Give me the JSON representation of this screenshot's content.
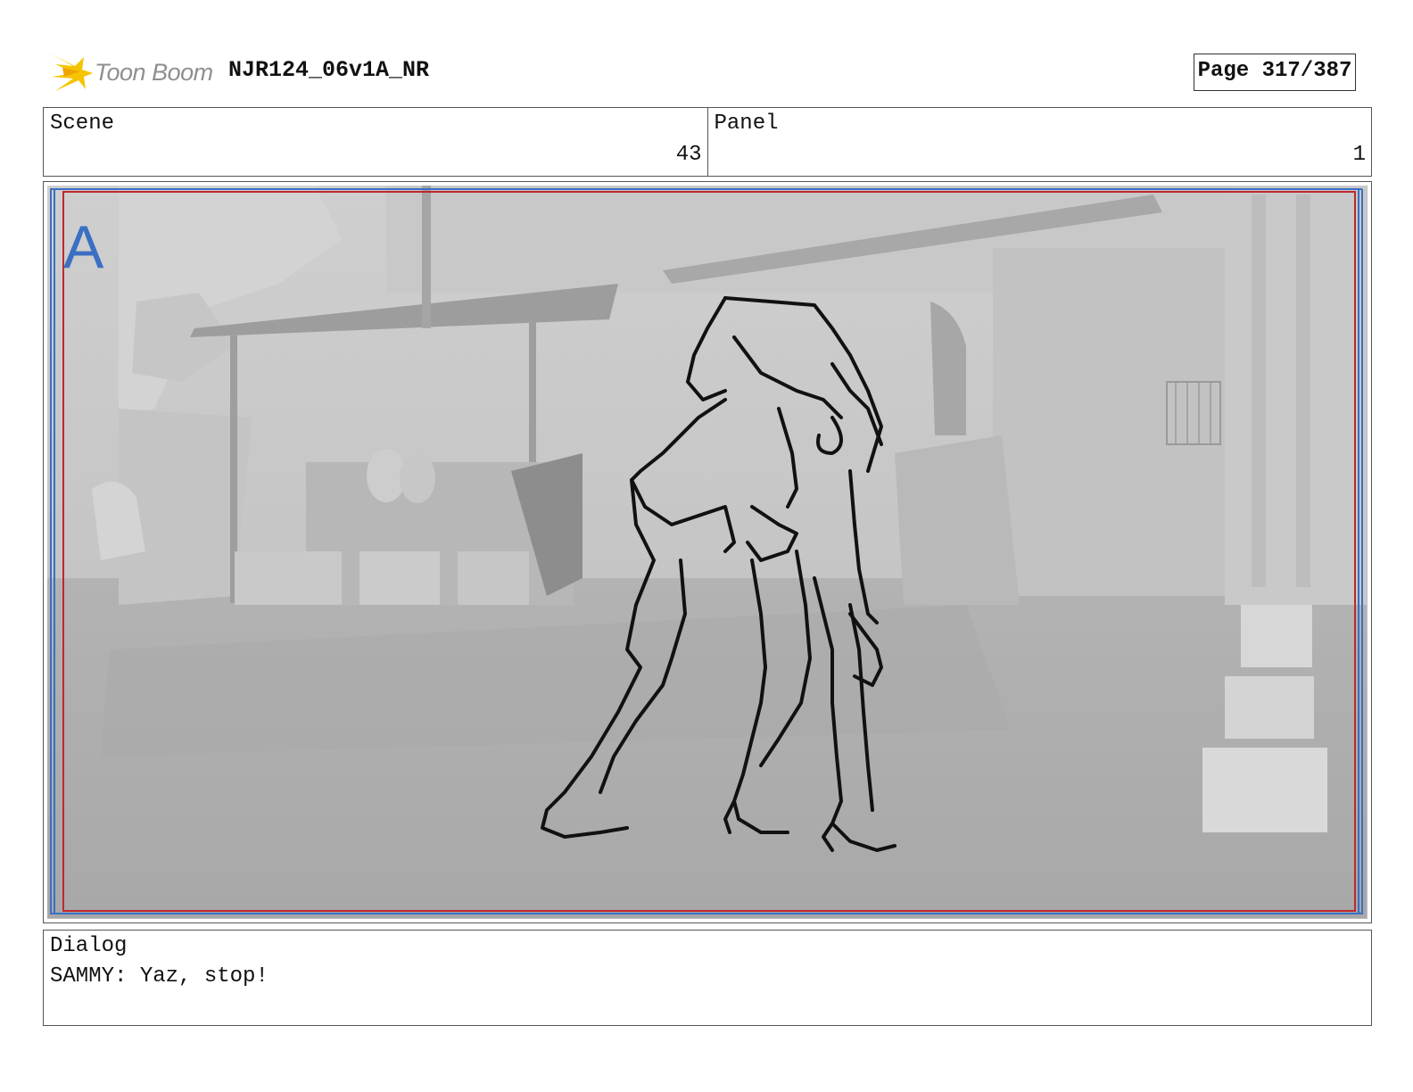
{
  "header": {
    "logo_text": "Toon Boom",
    "document_title": "NJR124_06v1A_NR",
    "page_indicator": "Page 317/387"
  },
  "scene": {
    "label": "Scene",
    "value": "43"
  },
  "panel": {
    "label": "Panel",
    "value": "1"
  },
  "frame": {
    "camera_label": "A"
  },
  "dialog": {
    "label": "Dialog",
    "text": "SAMMY: Yaz, stop!"
  },
  "colors": {
    "title_safe": "#c0272d",
    "action_safe": "#3b6fc4",
    "logo_accent": "#f5c400",
    "background_gray": "#bdbdbd"
  }
}
